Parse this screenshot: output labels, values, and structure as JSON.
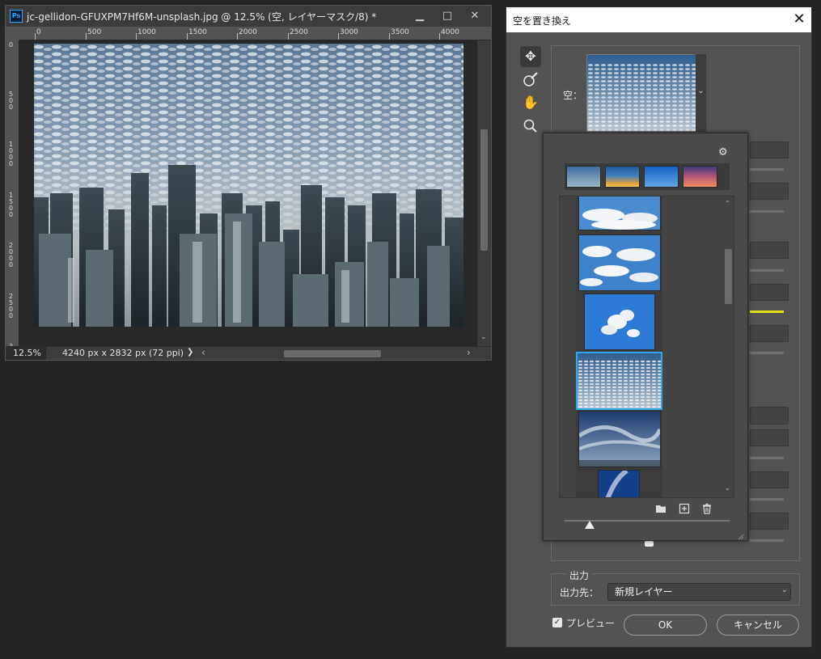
{
  "document": {
    "title": "jc-gellidon-GFUXPM7Hf6M-unsplash.jpg @ 12.5% (空, レイヤーマスク/8) *",
    "app_icon_text": "Ps",
    "window_buttons": {
      "minimize": "▁",
      "maximize": "□",
      "close": "✕"
    },
    "ruler_top_labels": [
      "0",
      "500",
      "1000",
      "1500",
      "2000",
      "2500",
      "3000",
      "3500",
      "4000"
    ],
    "ruler_left_labels": [
      "0",
      "500",
      "1000",
      "1500",
      "2000",
      "2500",
      "3"
    ],
    "zoom": "12.5%",
    "doc_info": "4240 px x 2832 px (72 ppi)",
    "status_arrow": "❯",
    "hscroll_left": "‹",
    "hscroll_right": "›",
    "vscroll_down": "⌄"
  },
  "dialog": {
    "title": "空を置き換え",
    "close_icon": "✕",
    "tools": [
      {
        "name": "move-tool",
        "icon": "move-icon",
        "glyph": "✥"
      },
      {
        "name": "sky-brush-tool",
        "icon": "brush-icon",
        "glyph": "⬮"
      },
      {
        "name": "hand-tool",
        "icon": "hand-icon",
        "glyph": "✋"
      },
      {
        "name": "zoom-tool",
        "icon": "zoom-icon",
        "glyph": "🔍︎"
      }
    ],
    "sky_label": "空：",
    "sky_dropdown_arrow": "⌄",
    "output": {
      "group_title": "出力",
      "label": "出力先：",
      "value": "新規レイヤー",
      "arrow": "⌄"
    },
    "preview": {
      "checked": true,
      "check_glyph": "✓",
      "label": "プレビュー"
    },
    "ok_label": "OK",
    "cancel_label": "キャンセル"
  },
  "preset_popup": {
    "gear_glyph": "⚙",
    "groups": [
      "blue-sky",
      "spectacular",
      "sunset-blue",
      "sunset-pink"
    ],
    "sky_presets": [
      "cumulus-top",
      "cumulus-scattered",
      "cumulus-tall",
      "altocumulus-selected",
      "cirrus-streaks",
      "cirrus-partial"
    ],
    "selected_index": 3,
    "scroll_up": "⌃",
    "scroll_down": "⌄",
    "icons": {
      "folder": "🗀",
      "new": "⊞",
      "delete": "🗑"
    },
    "thumbnail_size": 0.15,
    "accent_color": "#2fa8e8"
  },
  "colors": {
    "panel": "#535353",
    "selection": "#2fa8e8",
    "hidden_slider_accent": "#e4e00c"
  }
}
